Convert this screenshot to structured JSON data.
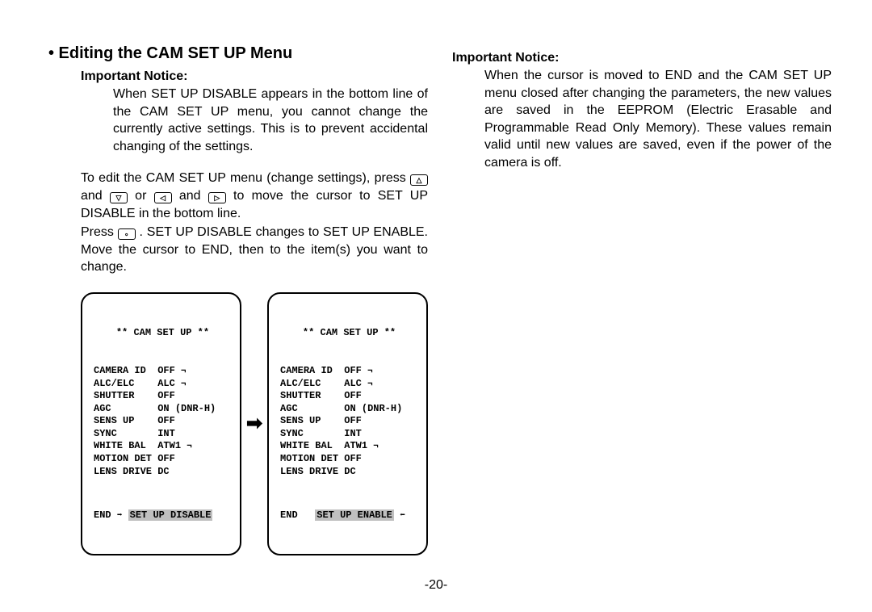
{
  "heading": "• Editing the CAM SET UP Menu",
  "notice_label": "Important Notice:",
  "notice1_text": "When SET UP DISABLE appears in the bottom line of the CAM SET UP menu, you cannot change the currently active settings. This is to prevent acciden­tal changing of the settings.",
  "para1_a": "To edit the CAM SET UP menu (change settings), press ",
  "para1_b": " and ",
  "para1_c": " or ",
  "para1_d": " and ",
  "para1_e": "  to move the cursor to SET UP DISABLE in the bottom line.",
  "para2_a": "Press  ",
  "para2_b": " .  SET  UP  DISABLE  changes  to  SET  UP ENABLE. Move the cursor to END, then to the item(s) you want to change.",
  "notice2_text": "When the cursor is moved to END and the CAM SET UP menu closed after changing the parame­ters, the new values are saved in the EEPROM (Electric Erasable and Programmable Read Only Memory). These values remain valid until new val­ues are saved, even if the power of the camera is off.",
  "menu": {
    "title": "** CAM SET UP **",
    "rows": [
      [
        "CAMERA ID",
        "OFF ",
        true
      ],
      [
        "ALC/ELC",
        "ALC ",
        true
      ],
      [
        "SHUTTER",
        "OFF",
        false
      ],
      [
        "AGC",
        "ON (DNR-H)",
        false
      ],
      [
        "SENS UP",
        "OFF",
        false
      ],
      [
        "SYNC",
        "INT",
        false
      ],
      [
        "WHITE BAL",
        "ATW1 ",
        true
      ],
      [
        "MOTION DET",
        "OFF",
        false
      ],
      [
        "LENS DRIVE",
        "DC",
        false
      ]
    ],
    "end_label": "END",
    "state_disable": "SET UP DISABLE",
    "state_enable": "SET UP ENABLE"
  },
  "page_number": "-20-"
}
